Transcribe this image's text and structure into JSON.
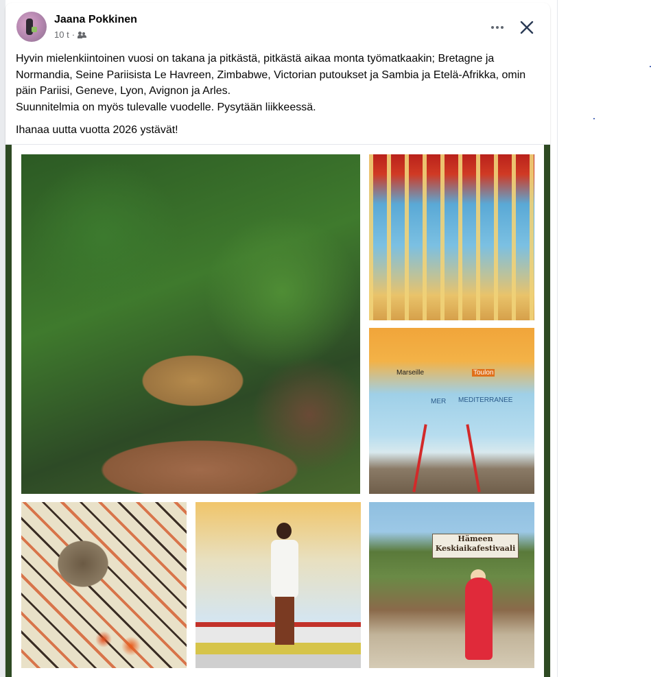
{
  "post": {
    "author": "Jaana Pokkinen",
    "time": "10 t",
    "separator": "·",
    "audience_icon": "friends-icon",
    "text_p1": "Hyvin mielenkiintoinen vuosi on  takana ja pitkästä, pitkästä aikaa monta työmatkaakin; Bretagne ja Normandia, Seine Pariisista Le Havreen, Zimbabwe, Victorian putoukset ja Sambia ja Etelä-Afrikka, omin päin Pariisi, Geneve, Lyon, Avignon ja Arles.",
    "text_p2": "Suunnitelmia on myös tulevalle vuodelle. Pysytään liikkeessä.",
    "text_p3": "Ihanaa uutta vuotta 2026 ystävät!"
  },
  "collage": {
    "photos": [
      {
        "name": "leopard-photo",
        "icon": "photo"
      },
      {
        "name": "church-photo",
        "icon": "photo"
      },
      {
        "name": "lamp-map-photo",
        "icon": "photo"
      },
      {
        "name": "dog-photo",
        "icon": "photo"
      },
      {
        "name": "man-in-white-photo",
        "icon": "photo"
      },
      {
        "name": "festival-photo",
        "icon": "photo"
      }
    ],
    "festival_sign_line1": "Hämeen",
    "festival_sign_line2": "Keskiaikafestivaali",
    "map_label_city1": "Marseille",
    "map_label_city2": "Toulon",
    "map_label_sea1": "MER",
    "map_label_sea2": "MEDITERRANEE"
  },
  "colors": {
    "author": "#050505",
    "meta": "#65676b",
    "frame_green": "#2e4a23"
  }
}
